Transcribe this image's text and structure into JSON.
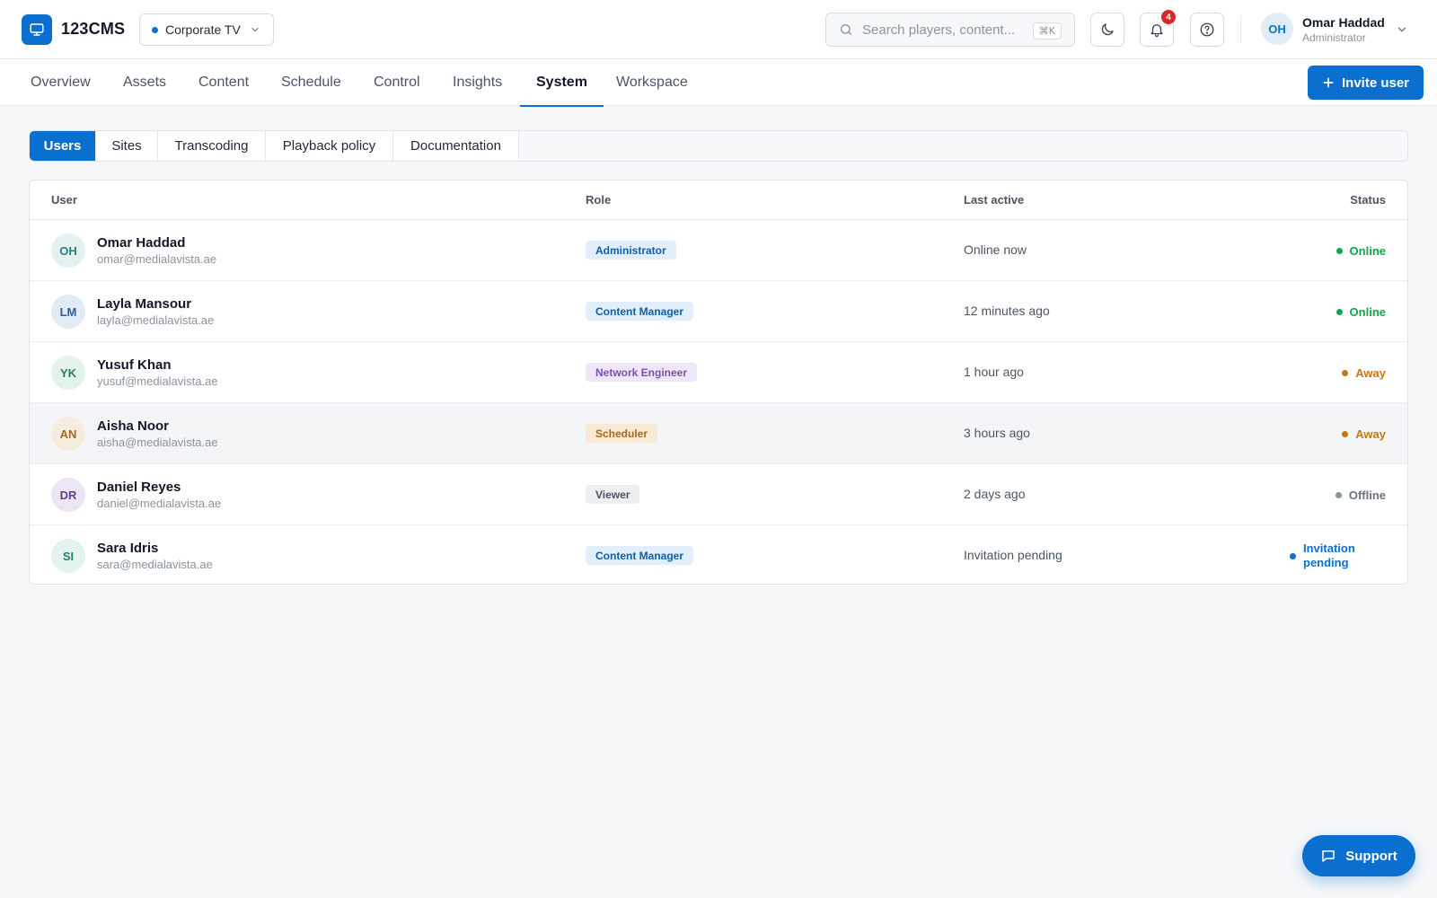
{
  "app": {
    "name": "123CMS",
    "icon": "monitor-icon",
    "brand_color": "#0b6fcf"
  },
  "workspace": {
    "name": "Corporate TV"
  },
  "search": {
    "placeholder": "Search players, content...",
    "shortcut": "⌘K"
  },
  "header": {
    "notifications_count": "4",
    "user": {
      "initials": "OH",
      "name": "Omar Haddad",
      "role": "Administrator"
    }
  },
  "nav": {
    "tabs": [
      {
        "label": "Overview"
      },
      {
        "label": "Assets"
      },
      {
        "label": "Content"
      },
      {
        "label": "Schedule"
      },
      {
        "label": "Control"
      },
      {
        "label": "Insights"
      },
      {
        "label": "System",
        "active": true
      },
      {
        "label": "Workspace"
      }
    ],
    "invite_label": "Invite user"
  },
  "subtabs": [
    {
      "label": "Users",
      "active": true
    },
    {
      "label": "Sites"
    },
    {
      "label": "Transcoding"
    },
    {
      "label": "Playback policy"
    },
    {
      "label": "Documentation"
    }
  ],
  "table": {
    "columns": {
      "user": "User",
      "role": "Role",
      "last_active": "Last active",
      "status": "Status"
    },
    "rows": [
      {
        "initials": "OH",
        "name": "Omar Haddad",
        "email": "omar@medialavista.ae",
        "role": "Administrator",
        "last_active": "Online now",
        "status": "Online"
      },
      {
        "initials": "LM",
        "name": "Layla Mansour",
        "email": "layla@medialavista.ae",
        "role": "Content Manager",
        "last_active": "12 minutes ago",
        "status": "Online"
      },
      {
        "initials": "YK",
        "name": "Yusuf Khan",
        "email": "yusuf@medialavista.ae",
        "role": "Network Engineer",
        "last_active": "1 hour ago",
        "status": "Away"
      },
      {
        "initials": "AN",
        "name": "Aisha Noor",
        "email": "aisha@medialavista.ae",
        "role": "Scheduler",
        "last_active": "3 hours ago",
        "status": "Away"
      },
      {
        "initials": "DR",
        "name": "Daniel Reyes",
        "email": "daniel@medialavista.ae",
        "role": "Viewer",
        "last_active": "2 days ago",
        "status": "Offline"
      },
      {
        "initials": "SI",
        "name": "Sara Idris",
        "email": "sara@medialavista.ae",
        "role": "Content Manager",
        "last_active": "Invitation pending",
        "status": "Invitation pending"
      }
    ]
  },
  "status_colors": {
    "online": "#16a34a",
    "away": "#c2790f",
    "offline": "#8a93a0",
    "pending": "#0b6fcf"
  },
  "support": {
    "label": "Support"
  }
}
